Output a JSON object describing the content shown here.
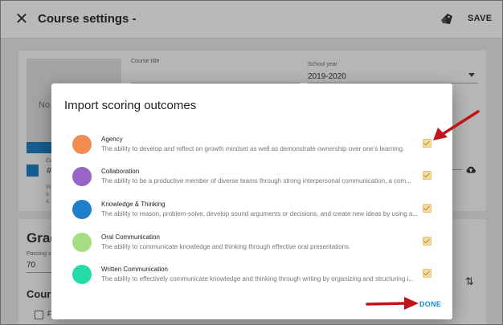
{
  "app_bar": {
    "title": "Course settings -",
    "save_label": "SAVE"
  },
  "background": {
    "course_title_label": "Course title",
    "school_year_label": "School year",
    "school_year_value": "2019-2020",
    "no_image_text": "No",
    "color_hash": "#",
    "small_text_a": "Co",
    "small_text_b": "W",
    "small_text_c": "a",
    "small_text_d": "4.",
    "grading_heading": "Grad",
    "passing_label": "Passing s",
    "passing_value": "70",
    "course_heading": "Cours",
    "checkbox_text": "F"
  },
  "dialog": {
    "title": "Import scoring outcomes",
    "done_label": "DONE",
    "outcomes": [
      {
        "name": "Agency",
        "description": "The ability to develop and reflect on growth mindset as well as demonstrate ownership over one's learning.",
        "color": "#f28b50",
        "checked": true
      },
      {
        "name": "Collaboration",
        "description": "The ability to be a productive member of diverse teams through strong interpersonal communication, a com...",
        "color": "#9866c8",
        "checked": true
      },
      {
        "name": "Knowledge & Thinking",
        "description": "The ability to reason, problem-solve, develop sound arguments or decisions, and create new ideas by using a...",
        "color": "#1e7fcb",
        "checked": true
      },
      {
        "name": "Oral Communication",
        "description": "The ability to communicate knowledge and thinking through effective oral presentations.",
        "color": "#a6dc82",
        "checked": true
      },
      {
        "name": "Written Communication",
        "description": "The ability to effectively communicate knowledge and thinking through writing by organizing and structuring i...",
        "color": "#25dba8",
        "checked": true
      }
    ]
  },
  "colors": {
    "accent": "#1b8ad1",
    "annotation_arrow": "#c0141b",
    "checkbox": "#f6dca3"
  }
}
